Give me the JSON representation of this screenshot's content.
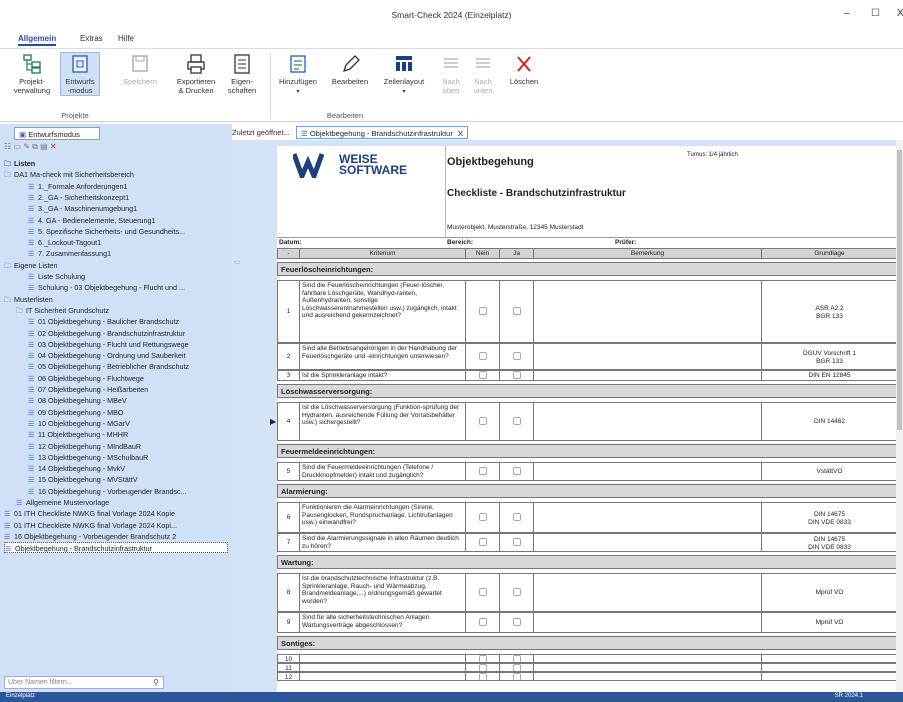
{
  "window": {
    "title": "Smart-Check 2024 (Einzelplatz)",
    "minimize": "–",
    "maximize": "☐",
    "close": "X"
  },
  "ribbon": {
    "tabs": [
      "Allgemein",
      "Extras",
      "Hilfe"
    ],
    "buttons": [
      {
        "label": "Projekt-\nverwaltung",
        "icon": "project-icon"
      },
      {
        "label": "Entwurfs\n-modus",
        "icon": "design-mode-icon"
      },
      {
        "label": "Speichern",
        "icon": "save-icon"
      },
      {
        "label": "Exportieren\n& Drucken",
        "icon": "print-icon"
      },
      {
        "label": "Eigen-\nschaften",
        "icon": "properties-icon"
      },
      {
        "label": "Hinzufügen",
        "icon": "add-icon"
      },
      {
        "label": "Bearbeiten",
        "icon": "edit-icon"
      },
      {
        "label": "Zeilenlayout",
        "icon": "layout-icon"
      },
      {
        "label": "Nach\noben",
        "icon": "move-up-icon"
      },
      {
        "label": "Nach\nunten",
        "icon": "move-down-icon"
      },
      {
        "label": "Löschen",
        "icon": "delete-icon"
      }
    ],
    "groups": [
      "Projekte",
      "Bearbeiten"
    ]
  },
  "left": {
    "tab": "Entwurfsmodus",
    "filter_placeholder": "Über Namen filtern...",
    "tree": [
      {
        "label": "Listen",
        "level": 0,
        "icon": "folder",
        "root": true
      },
      {
        "label": "DA1  Ma-check mit Sicherheitsbereich",
        "level": 0,
        "icon": "folder"
      },
      {
        "label": "1._Formale Anforderungen1",
        "level": 2,
        "icon": "list"
      },
      {
        "label": "2._GA - Sicherheitskonzept1",
        "level": 2,
        "icon": "list"
      },
      {
        "label": "3._GA - Maschinenumgebung1",
        "level": 2,
        "icon": "list"
      },
      {
        "label": "4. GA - Bedienelemente, Steuerung1",
        "level": 2,
        "icon": "list"
      },
      {
        "label": "5. Spezifische Sicherheits- und Gesundheits...",
        "level": 2,
        "icon": "list"
      },
      {
        "label": "6._Lockout-Tagout1",
        "level": 2,
        "icon": "list"
      },
      {
        "label": "7. Zusammenfassung1",
        "level": 2,
        "icon": "list"
      },
      {
        "label": "Eigene Listen",
        "level": 0,
        "icon": "folder"
      },
      {
        "label": "Liste Schulung",
        "level": 2,
        "icon": "list"
      },
      {
        "label": "Schulung - 03 Objektbegehung - Flucht und ...",
        "level": 2,
        "icon": "list"
      },
      {
        "label": "Musterlisten",
        "level": 0,
        "icon": "folder"
      },
      {
        "label": "IT Sicherheit Grundschutz",
        "level": 1,
        "icon": "folder"
      },
      {
        "label": "01 Objektbegehung - Baulicher Brandschutz",
        "level": 2,
        "icon": "list"
      },
      {
        "label": "02 Objektbegehung - Brandschutzinfrastruktur",
        "level": 2,
        "icon": "list"
      },
      {
        "label": "03 Objektbegehung - Flucht und Rettungswege",
        "level": 2,
        "icon": "list"
      },
      {
        "label": "04 Objektbegehung - Ordnung und Sauberkeit",
        "level": 2,
        "icon": "list"
      },
      {
        "label": "05 Objektbegehung - Betrieblicher Brandschutz",
        "level": 2,
        "icon": "list"
      },
      {
        "label": "06 Objektbegehung - Fluchtwege",
        "level": 2,
        "icon": "list"
      },
      {
        "label": "07 Objektbegehung - Heißarbeiten",
        "level": 2,
        "icon": "list"
      },
      {
        "label": "08 Objektbegehung - MBeV",
        "level": 2,
        "icon": "list"
      },
      {
        "label": "09 Objektbegehung - MBO",
        "level": 2,
        "icon": "list"
      },
      {
        "label": "10 Objektbegehung - MGarV",
        "level": 2,
        "icon": "list"
      },
      {
        "label": "11 Objektbegehung - MHHR",
        "level": 2,
        "icon": "list"
      },
      {
        "label": "12 Objektbegehung - MIndBauR",
        "level": 2,
        "icon": "list"
      },
      {
        "label": "13 Objektbegehung - MSchulbauR",
        "level": 2,
        "icon": "list"
      },
      {
        "label": "14 Objektbegehung - MvkV",
        "level": 2,
        "icon": "list"
      },
      {
        "label": "15 Objektbegehung - MVStättV",
        "level": 2,
        "icon": "list"
      },
      {
        "label": "16 Objektbegehung - Vorbeugender Brandsc...",
        "level": 2,
        "icon": "list"
      },
      {
        "label": "Allgemeine Mustervorlage",
        "level": 1,
        "icon": "list"
      },
      {
        "label": "01 ITH Checkliste NWKG final Vorlage 2024 Kopie",
        "level": 0,
        "icon": "list"
      },
      {
        "label": "01 ITH Checkliste NWKG final Vorlage 2024 Kopi...",
        "level": 0,
        "icon": "list"
      },
      {
        "label": "16 Objektbegehung - Vorbeugender Brandschutz 2",
        "level": 0,
        "icon": "list"
      },
      {
        "label": "Objektbegehung - Brandschutzinfrastruktur",
        "level": 0,
        "icon": "list",
        "selected": true
      }
    ]
  },
  "docbar": {
    "recent": "Zuletzt geöffnet...",
    "tab": "Objektbegehung - Brandschutzinfrastruktur",
    "tab_close": "X"
  },
  "doc": {
    "logo_line1": "WEISE",
    "logo_line2": "SOFTWARE",
    "title": "Objektbegehung",
    "turnus": "Turnus: 1/4 jährlich",
    "subtitle": "Checkliste - Brandschutzinfrastruktur",
    "address": "Musterobjekt, Musterstraße, 12345 Musterstadt",
    "datum": "Datum:",
    "bereich": "Bereich:",
    "pruefer": "Prüfer:",
    "headers": [
      "-",
      "Kriterium",
      "Nein",
      "Ja",
      "Bemerkung",
      "Grundlage"
    ],
    "sections": [
      {
        "name": "Feuerlöscheinrichtungen:",
        "rows": [
          {
            "nr": "1",
            "text": "Sind die Feuerlöscheinrichtungen (Feuer-löscher, fahrbare Löschgeräte, Wandhyd-ranten, Außenhydranten, sonstige Löschwasserentnahmestellen usw.) zugänglich, intakt und ausreichend gekennzeichnet?",
            "grund": "ASR A2.2\nBGR 133"
          },
          {
            "nr": "2",
            "text": "Sind alle Betriebsangehörigen in der Handhabung der Feuerlöschgeräte und -einrichtungen unterwiesen?",
            "grund": "DGUV Vorschrift 1\nBGR 133"
          },
          {
            "nr": "3",
            "text": "Ist die Sprinkleranlage intakt?",
            "grund": "DIN EN 12845"
          }
        ]
      },
      {
        "name": "Löschwasserversorgung:",
        "rows": [
          {
            "nr": "4",
            "text": "Ist die Löschwasserversorgung (Funktion-sprüfung der Hydranten, ausreichende Füllung der Vorratsbehälter usw.) sichergestellt?",
            "grund": "DIN 14462"
          }
        ]
      },
      {
        "name": "Feuermeldeeinrichtungen:",
        "rows": [
          {
            "nr": "5",
            "text": "Sind die Feuermeldeeinrichtungen (Telefone / Druckknopfmelder) intakt und zugänglich?",
            "grund": "VstättVO"
          }
        ]
      },
      {
        "name": "Alarmierung:",
        "rows": [
          {
            "nr": "6",
            "text": "Funktionieren die Alarmeinrichtungen (Sirene, Pausenglocken, Rundspruchanlage, Lichtrufanlagen usw.) einwandfrei?",
            "grund": "DIN 14675\nDIN VDE 0833"
          },
          {
            "nr": "7",
            "text": "Sind die Alarmierungssignale in allen Räumen deutlich zu hören?",
            "grund": "DIN 14675\nDIN VDE 0833"
          }
        ]
      },
      {
        "name": "Wartung:",
        "rows": [
          {
            "nr": "8",
            "text": "Ist die brandschutztechnische Infrastruktur (z.B. Sprinkleranlage, Rauch- und Wärmeabzug, Brandmeldeanlage,...) ordnungsgemäß gewartet worden?",
            "grund": "Mprüf VO"
          },
          {
            "nr": "9",
            "text": "Sind für alle sicherheitstechnischen Anlagen Wartungsverträge abgeschlossen?",
            "grund": "Mprüf VO"
          }
        ]
      },
      {
        "name": "Sontiges:",
        "rows": [
          {
            "nr": "10",
            "text": "",
            "grund": ""
          },
          {
            "nr": "11",
            "text": "",
            "grund": ""
          },
          {
            "nr": "12",
            "text": "",
            "grund": ""
          }
        ]
      }
    ]
  },
  "status": {
    "left": "Einzelplatz",
    "right": "SR 2024.1"
  }
}
